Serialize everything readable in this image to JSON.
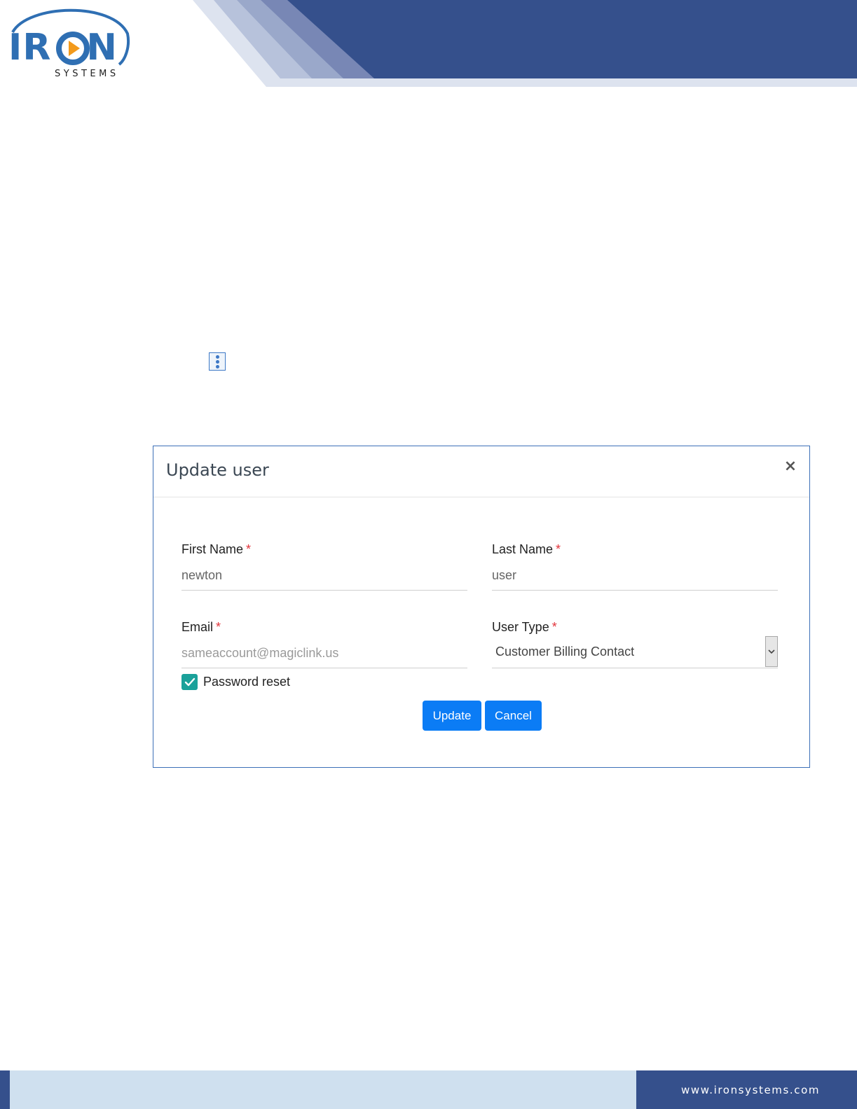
{
  "brand": {
    "logo_word_left": "IR",
    "logo_word_right": "N",
    "logo_sub": "SYSTEMS",
    "primary_color": "#35508c",
    "logo_color": "#2f6fb3",
    "accent_orange": "#f39a1b"
  },
  "modal": {
    "title": "Update user",
    "close_label": "×",
    "fields": {
      "first_name": {
        "label": "First Name",
        "required_mark": "*",
        "value": "newton"
      },
      "last_name": {
        "label": "Last Name",
        "required_mark": "*",
        "value": "user"
      },
      "email": {
        "label": "Email",
        "required_mark": "*",
        "value": "sameaccount@magiclink.us"
      },
      "user_type": {
        "label": "User Type",
        "required_mark": "*",
        "selected": "Customer Billing Contact"
      }
    },
    "password_reset": {
      "label": "Password reset",
      "checked": true
    },
    "buttons": {
      "update": "Update",
      "cancel": "Cancel"
    },
    "button_color": "#0b7cf5",
    "checkbox_color": "#1aa19a"
  },
  "footer": {
    "url": "www.ironsystems.com"
  }
}
